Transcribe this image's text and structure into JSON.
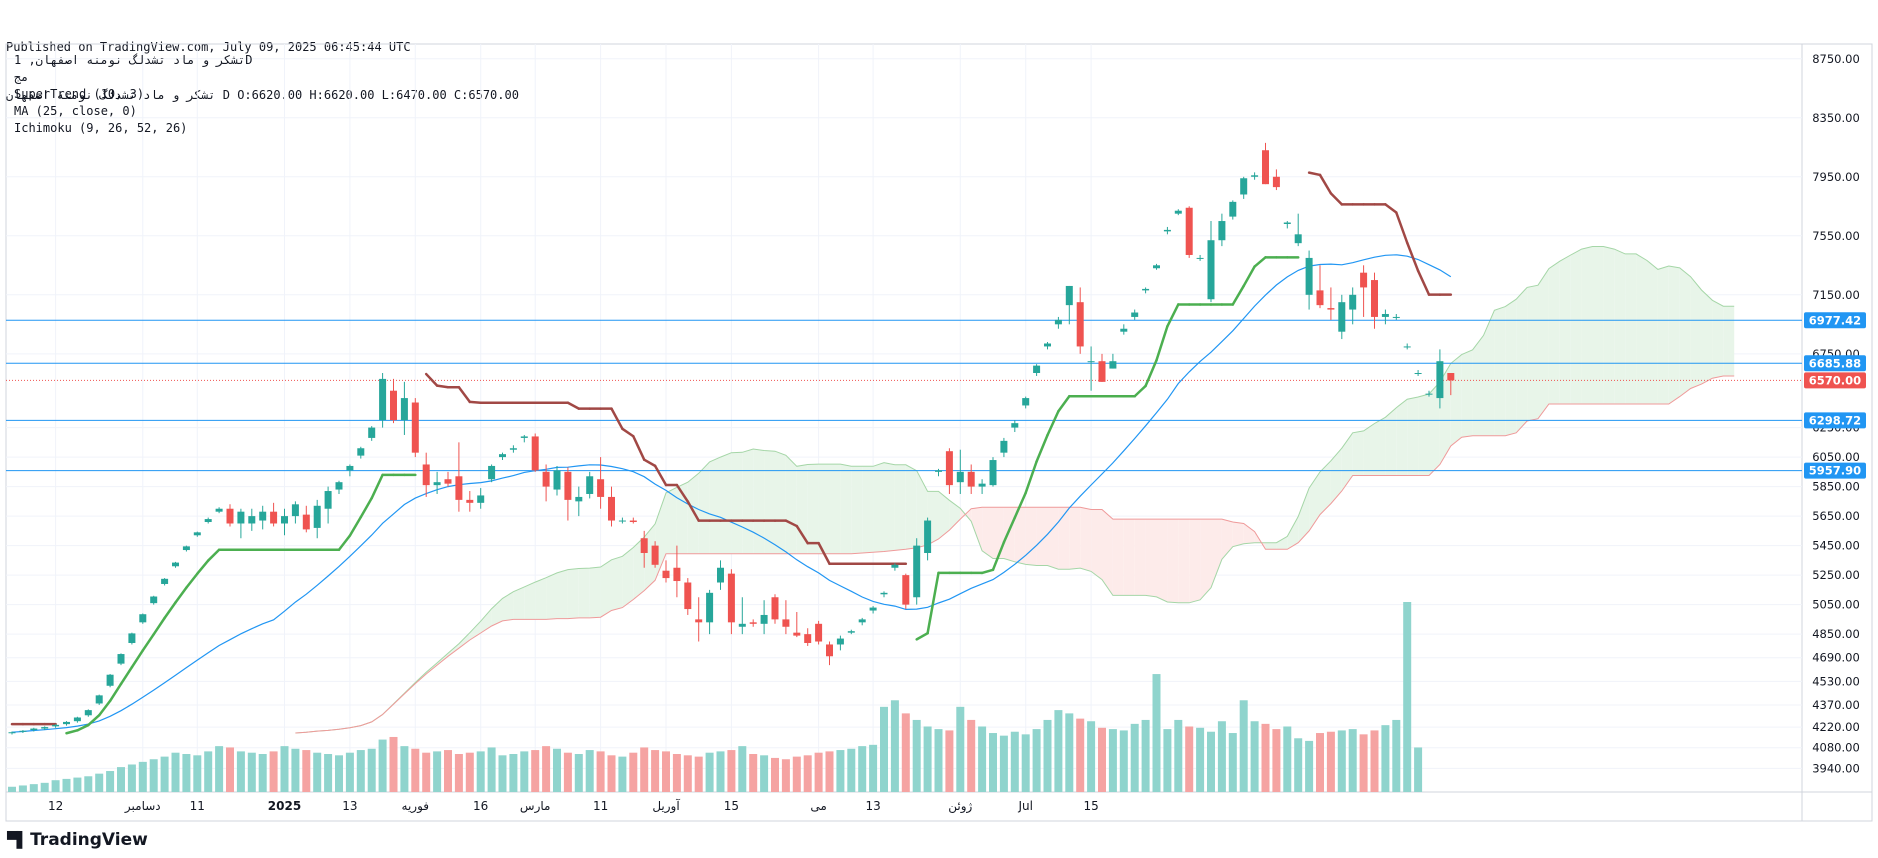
{
  "header": {
    "published": "Published on TradingView.com, July 09, 2025 06:45:44 UTC",
    "ohlc_line": "تشکر و ماد تشدلگ نومنه اصفهان D O:6620.00 H:6620.00 L:6470.00 C:6570.00"
  },
  "legend": {
    "symbol": "تشکر و ماد تشدلگ نومنه اصفهان, 1D",
    "exchange": "مج",
    "indicators": [
      "SuperTrend (10, 3)",
      "MA (25, close, 0)",
      "Ichimoku (9, 26, 52, 26)"
    ]
  },
  "brand": {
    "name": "TradingView",
    "icon": "tradingview-logo-icon"
  },
  "colors": {
    "up": "#26a69a",
    "down": "#ef5350",
    "up_volume": "#8fd4cd",
    "down_volume": "#f5a3a2",
    "supertrend_up": "#4caf50",
    "supertrend_down": "#a14845",
    "ma": "#2196f3",
    "cloud_bull": "#e8f5e9",
    "cloud_bear": "#fdebea",
    "level_line": "#2196f3",
    "last_price": "#ef5350"
  },
  "chart_data": {
    "type": "candlestick",
    "y_scale": {
      "min": 3780,
      "max": 8850,
      "ticks": [
        3940,
        4080,
        4220,
        4370,
        4530,
        4690,
        4850,
        5050,
        5250,
        5450,
        5650,
        5850,
        6050,
        6250,
        6750,
        7150,
        7550,
        7950,
        8350,
        8750
      ]
    },
    "x_ticks": [
      {
        "label": "12",
        "index": 4
      },
      {
        "label": "دسامبر",
        "index": 12
      },
      {
        "label": "11",
        "index": 17
      },
      {
        "label": "2025",
        "index": 25,
        "bold": true
      },
      {
        "label": "13",
        "index": 31
      },
      {
        "label": "فوریه",
        "index": 37
      },
      {
        "label": "16",
        "index": 43
      },
      {
        "label": "مارس",
        "index": 48
      },
      {
        "label": "11",
        "index": 54
      },
      {
        "label": "آوریل",
        "index": 60
      },
      {
        "label": "15",
        "index": 66
      },
      {
        "label": "می",
        "index": 74
      },
      {
        "label": "13",
        "index": 79
      },
      {
        "label": "ژوئن",
        "index": 87
      },
      {
        "label": "Jul",
        "index": 93
      },
      {
        "label": "15",
        "index": 99
      }
    ],
    "horizontal_levels": [
      6977.42,
      6685.88,
      6298.72,
      5957.9
    ],
    "last_price": 6570.0,
    "candles": [
      [
        4180,
        4190,
        4170,
        4185
      ],
      [
        4190,
        4200,
        4180,
        4195
      ],
      [
        4200,
        4215,
        4190,
        4210
      ],
      [
        4210,
        4225,
        4200,
        4220
      ],
      [
        4225,
        4240,
        4215,
        4235
      ],
      [
        4240,
        4260,
        4230,
        4255
      ],
      [
        4260,
        4290,
        4250,
        4285
      ],
      [
        4300,
        4340,
        4290,
        4335
      ],
      [
        4380,
        4440,
        4370,
        4435
      ],
      [
        4500,
        4580,
        4490,
        4575
      ],
      [
        4650,
        4720,
        4640,
        4715
      ],
      [
        4790,
        4860,
        4780,
        4855
      ],
      [
        4930,
        4990,
        4920,
        4985
      ],
      [
        5060,
        5110,
        5050,
        5105
      ],
      [
        5190,
        5230,
        5180,
        5225
      ],
      [
        5310,
        5340,
        5300,
        5335
      ],
      [
        5420,
        5450,
        5410,
        5445
      ],
      [
        5520,
        5545,
        5510,
        5540
      ],
      [
        5610,
        5640,
        5600,
        5630
      ],
      [
        5680,
        5710,
        5670,
        5700
      ],
      [
        5700,
        5730,
        5580,
        5600
      ],
      [
        5600,
        5700,
        5500,
        5680
      ],
      [
        5600,
        5700,
        5550,
        5650
      ],
      [
        5620,
        5720,
        5560,
        5680
      ],
      [
        5680,
        5740,
        5580,
        5600
      ],
      [
        5600,
        5700,
        5520,
        5650
      ],
      [
        5650,
        5750,
        5600,
        5730
      ],
      [
        5660,
        5720,
        5540,
        5560
      ],
      [
        5570,
        5760,
        5500,
        5720
      ],
      [
        5700,
        5850,
        5600,
        5820
      ],
      [
        5830,
        5890,
        5800,
        5880
      ],
      [
        5960,
        6000,
        5920,
        5990
      ],
      [
        6060,
        6120,
        6040,
        6110
      ],
      [
        6180,
        6260,
        6160,
        6250
      ],
      [
        6300,
        6620,
        6250,
        6580
      ],
      [
        6500,
        6580,
        6280,
        6300
      ],
      [
        6300,
        6560,
        6200,
        6450
      ],
      [
        6420,
        6450,
        6050,
        6080
      ],
      [
        6000,
        6080,
        5780,
        5860
      ],
      [
        5860,
        5950,
        5800,
        5880
      ],
      [
        5900,
        5950,
        5850,
        5870
      ],
      [
        5920,
        6150,
        5680,
        5760
      ],
      [
        5760,
        5820,
        5680,
        5740
      ],
      [
        5740,
        5840,
        5700,
        5790
      ],
      [
        5900,
        6000,
        5880,
        5990
      ],
      [
        6050,
        6080,
        6030,
        6070
      ],
      [
        6100,
        6130,
        6080,
        6110
      ],
      [
        6180,
        6200,
        6150,
        6190
      ],
      [
        6190,
        6210,
        5950,
        5960
      ],
      [
        5950,
        6000,
        5750,
        5850
      ],
      [
        5830,
        5990,
        5790,
        5960
      ],
      [
        5950,
        5980,
        5620,
        5760
      ],
      [
        5750,
        5850,
        5650,
        5780
      ],
      [
        5800,
        5950,
        5770,
        5920
      ],
      [
        5900,
        6050,
        5700,
        5780
      ],
      [
        5780,
        5850,
        5580,
        5620
      ],
      [
        5620,
        5640,
        5600,
        5620
      ],
      [
        5620,
        5640,
        5600,
        5610
      ],
      [
        5500,
        5550,
        5300,
        5400
      ],
      [
        5450,
        5480,
        5300,
        5320
      ],
      [
        5280,
        5350,
        5200,
        5230
      ],
      [
        5300,
        5450,
        5100,
        5210
      ],
      [
        5200,
        5230,
        4980,
        5020
      ],
      [
        4950,
        5100,
        4800,
        4930
      ],
      [
        4930,
        5150,
        4850,
        5130
      ],
      [
        5200,
        5350,
        5150,
        5300
      ],
      [
        5260,
        5290,
        4850,
        4930
      ],
      [
        4900,
        5100,
        4850,
        4920
      ],
      [
        4930,
        4950,
        4900,
        4920
      ],
      [
        4920,
        5080,
        4850,
        4980
      ],
      [
        5100,
        5120,
        4920,
        4950
      ],
      [
        4950,
        5080,
        4850,
        4900
      ],
      [
        4860,
        5000,
        4830,
        4840
      ],
      [
        4850,
        4890,
        4770,
        4790
      ],
      [
        4920,
        4940,
        4780,
        4800
      ],
      [
        4780,
        4800,
        4640,
        4700
      ],
      [
        4780,
        4840,
        4740,
        4820
      ],
      [
        4860,
        4880,
        4850,
        4870
      ],
      [
        4930,
        4960,
        4910,
        4950
      ],
      [
        5010,
        5040,
        4990,
        5030
      ],
      [
        5120,
        5140,
        5100,
        5130
      ],
      [
        5300,
        5330,
        5280,
        5320
      ],
      [
        5250,
        5260,
        5020,
        5050
      ],
      [
        5100,
        5500,
        5050,
        5450
      ],
      [
        5400,
        5640,
        5350,
        5620
      ],
      [
        5950,
        5970,
        5920,
        5960
      ],
      [
        6090,
        6110,
        5800,
        5860
      ],
      [
        5880,
        6100,
        5800,
        5950
      ],
      [
        5950,
        6000,
        5800,
        5850
      ],
      [
        5850,
        5900,
        5800,
        5870
      ],
      [
        5860,
        6050,
        5850,
        6030
      ],
      [
        6080,
        6180,
        6050,
        6160
      ],
      [
        6250,
        6300,
        6220,
        6280
      ],
      [
        6400,
        6460,
        6380,
        6450
      ],
      [
        6620,
        6680,
        6600,
        6670
      ],
      [
        6800,
        6830,
        6780,
        6820
      ],
      [
        6950,
        7000,
        6920,
        6980
      ],
      [
        7080,
        7210,
        6950,
        7210
      ],
      [
        7100,
        7200,
        6750,
        6800
      ],
      [
        6700,
        6800,
        6500,
        6700
      ],
      [
        6700,
        6750,
        6560,
        6560
      ],
      [
        6650,
        6750,
        6650,
        6700
      ],
      [
        6900,
        6950,
        6880,
        6920
      ],
      [
        7000,
        7050,
        6980,
        7030
      ],
      [
        7180,
        7200,
        7160,
        7190
      ],
      [
        7330,
        7360,
        7320,
        7350
      ],
      [
        7580,
        7610,
        7560,
        7590
      ],
      [
        7700,
        7730,
        7690,
        7720
      ],
      [
        7740,
        7750,
        7400,
        7420
      ],
      [
        7400,
        7420,
        7380,
        7400
      ],
      [
        7120,
        7650,
        7100,
        7520
      ],
      [
        7520,
        7700,
        7480,
        7650
      ],
      [
        7680,
        7790,
        7660,
        7780
      ],
      [
        7830,
        7950,
        7800,
        7940
      ],
      [
        7950,
        7980,
        7930,
        7960
      ],
      [
        8130,
        8180,
        7900,
        7900
      ],
      [
        7950,
        8000,
        7860,
        7880
      ],
      [
        7630,
        7650,
        7600,
        7640
      ],
      [
        7500,
        7700,
        7480,
        7560
      ],
      [
        7150,
        7450,
        7050,
        7400
      ],
      [
        7180,
        7350,
        7060,
        7080
      ],
      [
        7060,
        7200,
        6980,
        7050
      ],
      [
        6900,
        7150,
        6850,
        7100
      ],
      [
        7050,
        7200,
        6950,
        7150
      ],
      [
        7300,
        7350,
        7000,
        7200
      ],
      [
        7250,
        7300,
        6920,
        7000
      ],
      [
        7000,
        7050,
        6950,
        7020
      ],
      [
        7000,
        7020,
        6980,
        7000
      ],
      [
        6800,
        6820,
        6780,
        6800
      ],
      [
        6620,
        6640,
        6600,
        6620
      ],
      [
        6480,
        6500,
        6460,
        6480
      ],
      [
        6450,
        6780,
        6380,
        6700
      ],
      [
        6620,
        6620,
        6470,
        6570
      ]
    ],
    "volume": [
      8,
      10,
      12,
      14,
      18,
      20,
      22,
      24,
      28,
      32,
      38,
      42,
      46,
      50,
      54,
      60,
      58,
      56,
      62,
      70,
      68,
      62,
      60,
      58,
      62,
      70,
      66,
      64,
      60,
      58,
      56,
      60,
      64,
      66,
      80,
      84,
      70,
      66,
      60,
      62,
      64,
      58,
      60,
      62,
      68,
      56,
      58,
      62,
      64,
      70,
      66,
      60,
      58,
      64,
      62,
      56,
      54,
      60,
      68,
      64,
      62,
      58,
      56,
      54,
      60,
      62,
      64,
      70,
      58,
      56,
      52,
      50,
      54,
      56,
      60,
      62,
      64,
      66,
      70,
      72,
      130,
      140,
      120,
      110,
      100,
      96,
      94,
      130,
      110,
      100,
      90,
      86,
      92,
      88,
      96,
      110,
      125,
      120,
      112,
      108,
      98,
      96,
      94,
      104,
      110,
      180,
      96,
      110,
      100,
      98,
      92,
      108,
      90,
      140,
      108,
      104,
      96,
      100,
      82,
      78,
      90,
      92,
      94,
      96,
      88,
      94,
      102,
      110,
      290,
      68
    ]
  }
}
